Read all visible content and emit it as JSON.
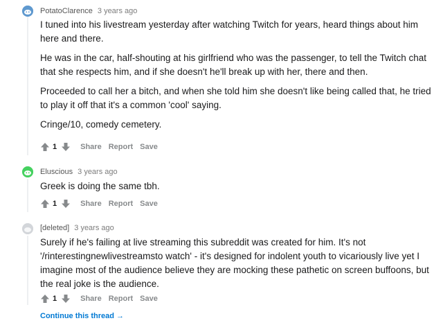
{
  "comments": [
    {
      "author": "PotatoClarence",
      "time": "3 years ago",
      "paragraphs": [
        "I tuned into his livestream yesterday after watching Twitch for years, heard things about him here and there.",
        "He was in the car, half-shouting at his girlfriend who was the passenger, to tell the Twitch chat that she respects him, and if she doesn't he'll break up with her, there and then.",
        "Proceeded to call her a bitch, and when she told him she doesn't like being called that, he tried to play it off that it's a common 'cool' saying.",
        "Cringe/10, comedy cemetery."
      ],
      "score": "1",
      "avatar_color": "#5f99cf"
    },
    {
      "author": "Eluscious",
      "time": "3 years ago",
      "paragraphs": [
        "Greek is doing the same tbh."
      ],
      "score": "1",
      "avatar_color": "#46d160"
    },
    {
      "author": "[deleted]",
      "time": "3 years ago",
      "paragraphs": [
        "Surely if he's failing at live streaming this subreddit was created for him. It's not '/rinterestingnewlivestreamsto watch' - it's designed for indolent youth to vicariously live yet I imagine most of the audience believe they are mocking these pathetic on screen buffoons, but the real joke is the audience."
      ],
      "score": "1",
      "avatar_color": "#d3d6da"
    }
  ],
  "actions": {
    "share": "Share",
    "report": "Report",
    "save": "Save"
  },
  "continue_thread": "Continue this thread →",
  "colors": {
    "upvote": "#878a8c",
    "link": "#0079d3"
  }
}
